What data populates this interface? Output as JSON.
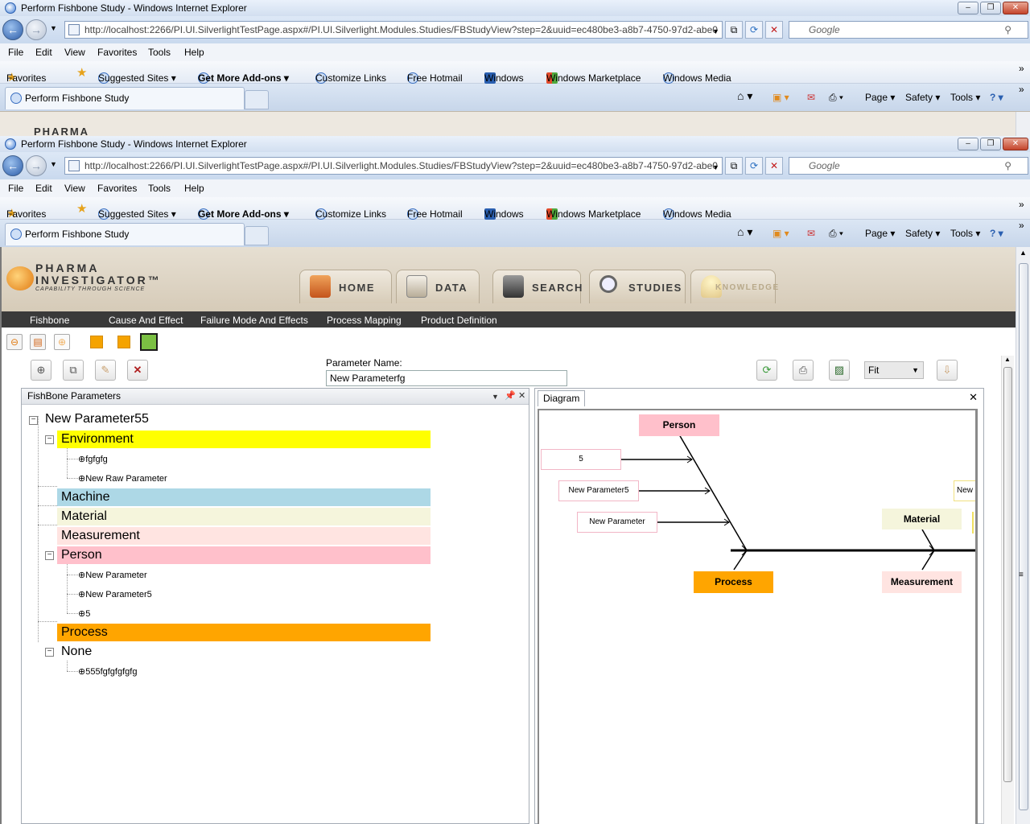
{
  "browser": {
    "title": "Perform Fishbone Study - Windows Internet Explorer",
    "url": "http://localhost:2266/PI.UI.SilverlightTestPage.aspx#/PI.UI.Silverlight.Modules.Studies/FBStudyView?step=2&uuid=ec480be3-a8b7-4750-97d2-abe0",
    "search_placeholder": "Google",
    "menu": [
      "File",
      "Edit",
      "View",
      "Favorites",
      "Tools",
      "Help"
    ],
    "favorites_label": "Favorites",
    "favorites": [
      "Suggested Sites ▾",
      "Get More Add-ons ▾",
      "Customize Links",
      "Free Hotmail",
      "Windows",
      "Windows Marketplace",
      "Windows Media"
    ],
    "tab_label": "Perform Fishbone Study",
    "commands": [
      "Page ▾",
      "Safety ▾",
      "Tools ▾"
    ],
    "peek_text": "PHARMA"
  },
  "app": {
    "logo_line1": "PHARMA",
    "logo_line2": "INVESTIGATOR™",
    "logo_tagline": "CAPABILITY THROUGH SCIENCE",
    "nav_tabs": [
      "Home",
      "Data",
      "Search",
      "Studies",
      "Knowledge"
    ],
    "menu": [
      "Fishbone",
      "Cause And Effect",
      "Failure Mode And Effects",
      "Process Mapping",
      "Product Definition"
    ],
    "parameter_label": "Parameter Name:",
    "parameter_value": "New Parameterfg",
    "zoom_option": "Fit",
    "colors": {
      "environment": "#ffff00",
      "machine": "#add8e6",
      "material": "#f5f5dc",
      "measurement": "#ffe4e1",
      "person": "#ffc0cb",
      "process": "#ffa500"
    }
  },
  "tree": {
    "panel_title": "FishBone Parameters",
    "root": "New Parameter55",
    "environment": "Environment",
    "env_items": [
      "fgfgfg",
      "New Raw Parameter"
    ],
    "machine": "Machine",
    "material": "Material",
    "measurement": "Measurement",
    "person": "Person",
    "person_items": [
      "New Parameter",
      "New Parameter5",
      "5"
    ],
    "process": "Process",
    "none": "None",
    "none_items": [
      "555fgfgfgfgfg"
    ]
  },
  "diagram": {
    "tab": "Diagram",
    "person": "Person",
    "process": "Process",
    "material": "Material",
    "measurement": "Measurement",
    "params": [
      "5",
      "New Parameter5",
      "New Parameter"
    ],
    "partial": "New"
  }
}
